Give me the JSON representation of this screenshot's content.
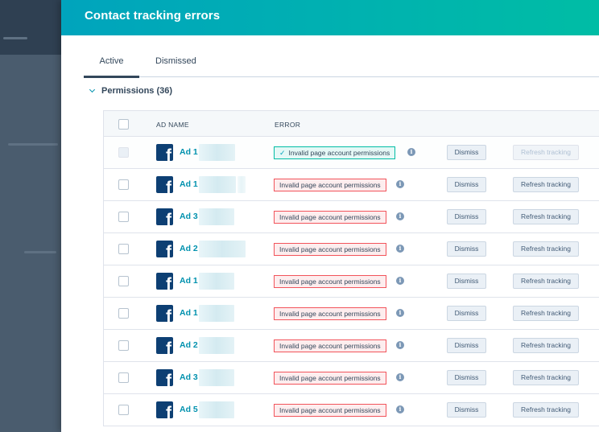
{
  "panel": {
    "title": "Contact tracking errors"
  },
  "tabs": [
    {
      "label": "Active",
      "active": true
    },
    {
      "label": "Dismissed",
      "active": false
    }
  ],
  "section": {
    "label": "Permissions (36)"
  },
  "table": {
    "columns": {
      "ad_name": "AD NAME",
      "error": "ERROR"
    },
    "rows": [
      {
        "ad": "Ad 1",
        "error": "Invalid page account permissions",
        "dismiss": "Dismiss",
        "refresh": "Refresh tracking",
        "selected": true
      },
      {
        "ad": "Ad 1",
        "error": "Invalid page account permissions",
        "dismiss": "Dismiss",
        "refresh": "Refresh tracking",
        "selected": false
      },
      {
        "ad": "Ad 3",
        "error": "Invalid page account permissions",
        "dismiss": "Dismiss",
        "refresh": "Refresh tracking",
        "selected": false
      },
      {
        "ad": "Ad 2",
        "error": "Invalid page account permissions",
        "dismiss": "Dismiss",
        "refresh": "Refresh tracking",
        "selected": false
      },
      {
        "ad": "Ad 1",
        "error": "Invalid page account permissions",
        "dismiss": "Dismiss",
        "refresh": "Refresh tracking",
        "selected": false
      },
      {
        "ad": "Ad 1",
        "error": "Invalid page account permissions",
        "dismiss": "Dismiss",
        "refresh": "Refresh tracking",
        "selected": false
      },
      {
        "ad": "Ad 2",
        "error": "Invalid page account permissions",
        "dismiss": "Dismiss",
        "refresh": "Refresh tracking",
        "selected": false
      },
      {
        "ad": "Ad 3",
        "error": "Invalid page account permissions",
        "dismiss": "Dismiss",
        "refresh": "Refresh tracking",
        "selected": false
      },
      {
        "ad": "Ad 5",
        "error": "Invalid page account permissions",
        "dismiss": "Dismiss",
        "refresh": "Refresh tracking",
        "selected": false
      }
    ]
  },
  "icons": {
    "platform": "facebook-icon",
    "info": "info-icon",
    "check": "check-icon"
  },
  "colors": {
    "header_start": "#00a4bd",
    "header_end": "#00bda5",
    "link": "#0091ae",
    "error_border": "#f2545b",
    "selected_border": "#00bda5"
  }
}
